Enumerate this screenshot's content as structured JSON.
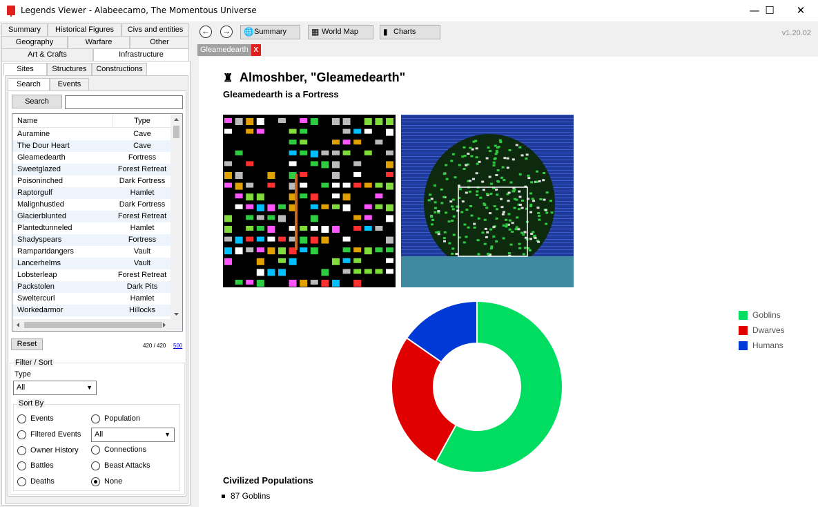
{
  "window": {
    "title": "Legends Viewer - Alabeecamo, The Momentous Universe",
    "minimize": "—",
    "maximize": "☐",
    "close": "✕"
  },
  "left": {
    "tabs_row1": [
      "Summary",
      "Historical Figures",
      "Civs and entities"
    ],
    "tabs_row2": [
      "Geography",
      "Warfare",
      "Other"
    ],
    "tabs_row3": [
      "Art & Crafts",
      "Infrastructure"
    ],
    "subtabs": [
      "Sites",
      "Structures",
      "Constructions"
    ],
    "search_tabs": [
      "Search",
      "Events"
    ],
    "search_button": "Search",
    "search_value": "",
    "columns": [
      "Name",
      "Type"
    ],
    "rows": [
      {
        "name": "Auramine",
        "type": "Cave"
      },
      {
        "name": "The Dour Heart",
        "type": "Cave"
      },
      {
        "name": "Gleamedearth",
        "type": "Fortress"
      },
      {
        "name": "Sweetglazed",
        "type": "Forest Retreat"
      },
      {
        "name": "Poisoninched",
        "type": "Dark Fortress"
      },
      {
        "name": "Raptorgulf",
        "type": "Hamlet"
      },
      {
        "name": "Malignhustled",
        "type": "Dark Fortress"
      },
      {
        "name": "Glacierblunted",
        "type": "Forest Retreat"
      },
      {
        "name": "Plantedtunneled",
        "type": "Hamlet"
      },
      {
        "name": "Shadyspears",
        "type": "Fortress"
      },
      {
        "name": "Rampartdangers",
        "type": "Vault"
      },
      {
        "name": "Lancerhelms",
        "type": "Vault"
      },
      {
        "name": "Lobsterleap",
        "type": "Forest Retreat"
      },
      {
        "name": "Packstolen",
        "type": "Dark Pits"
      },
      {
        "name": "Sweltercurl",
        "type": "Hamlet"
      },
      {
        "name": "Workedarmor",
        "type": "Hillocks"
      }
    ],
    "reset_button": "Reset",
    "count": "420 / 420",
    "page_link": "500",
    "filter_sort_label": "Filter / Sort",
    "type_label": "Type",
    "type_value": "All",
    "sort_by_label": "Sort By",
    "sort_options": {
      "events": "Events",
      "filtered_events": "Filtered Events",
      "owner_history": "Owner History",
      "battles": "Battles",
      "deaths": "Deaths",
      "population": "Population",
      "connections": "Connections",
      "beast_attacks": "Beast Attacks",
      "none": "None"
    },
    "population_filter_value": "All",
    "selected_sort": "none"
  },
  "toolbar": {
    "back": "←",
    "forward": "→",
    "summary": "Summary",
    "world_map": "World Map",
    "charts": "Charts",
    "version": "v1.20.02"
  },
  "doc_tab": {
    "label": "Gleamedearth",
    "close": "X"
  },
  "site": {
    "title": "Almoshber, \"Gleamedearth\"",
    "subtitle": "Gleamedearth is a Fortress",
    "populations_title": "Civilized Populations",
    "populations": [
      "87 Goblins"
    ]
  },
  "chart_data": {
    "type": "pie",
    "variant": "doughnut",
    "legend_position": "top-right",
    "labels": [
      "Goblins",
      "Dwarves",
      "Humans"
    ],
    "values": [
      87,
      40,
      23
    ],
    "colors": [
      "#00dd60",
      "#e00000",
      "#0039d6"
    ]
  }
}
